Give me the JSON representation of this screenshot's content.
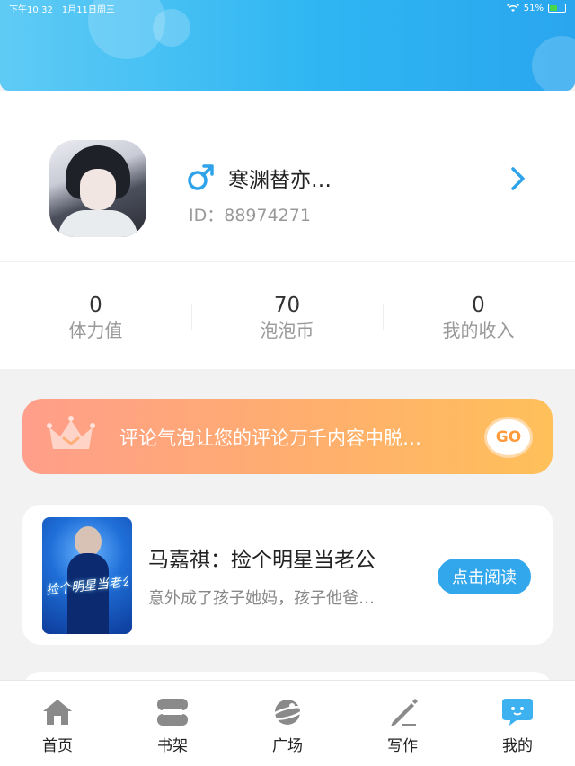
{
  "status_bar": {
    "time": "下午10:32",
    "date": "1月11日周三",
    "battery": "51%"
  },
  "profile": {
    "username": "寒渊替亦…",
    "id_label": "ID：",
    "id_value": "88974271"
  },
  "stats": [
    {
      "value": "0",
      "label": "体力值"
    },
    {
      "value": "70",
      "label": "泡泡币"
    },
    {
      "value": "0",
      "label": "我的收入"
    }
  ],
  "vip_banner": {
    "text": "评论气泡让您的评论万千内容中脱…",
    "go_label": "GO"
  },
  "book": {
    "title": "马嘉祺：捡个明星当老公",
    "description": "意外成了孩子她妈，孩子他爸…",
    "read_label": "点击阅读",
    "cover_text": "捡个明星当老公"
  },
  "tabs": [
    {
      "label": "首页",
      "icon": "home-icon"
    },
    {
      "label": "书架",
      "icon": "bookshelf-icon"
    },
    {
      "label": "广场",
      "icon": "planet-icon"
    },
    {
      "label": "写作",
      "icon": "pen-icon"
    },
    {
      "label": "我的",
      "icon": "chat-bubble-icon"
    }
  ],
  "colors": {
    "accent": "#33a7ec",
    "header": "#2fb6f2",
    "banner_start": "#ff9e8a",
    "banner_end": "#ffc05a"
  }
}
